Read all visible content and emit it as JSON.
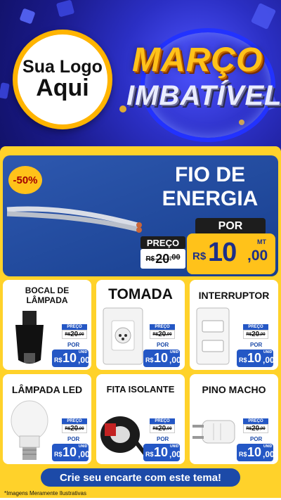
{
  "header": {
    "logo_line1": "Sua Logo",
    "logo_line2": "Aqui",
    "title_line1": "MARÇO",
    "title_line2": "IMBATÍVEL",
    "colors": {
      "background": "#2b2fc4",
      "title": "#ffc21a",
      "logo_ring": "#ffb400"
    }
  },
  "featured": {
    "discount": "-50%",
    "title_line1": "FIO DE",
    "title_line2": "ENERGIA",
    "por_label": "POR",
    "preco_label": "PREÇO",
    "old_currency": "R$",
    "old_int": "20",
    "old_cents": ",00",
    "currency": "R$",
    "price_int": "10",
    "price_cents": ",00",
    "unit": "MT",
    "image_icon": "wire-cable-icon"
  },
  "products": [
    {
      "name_line1": "BOCAL DE",
      "name_line2": "LÂMPADA",
      "icon": "socket-icon",
      "preco_label": "PREÇO",
      "old_currency": "R$",
      "old_int": "20",
      "old_cents": ",00",
      "por_label": "POR",
      "currency": "R$",
      "price_int": "10",
      "price_cents": ",00",
      "unit": "UNID"
    },
    {
      "name_line1": "TOMADA",
      "name_line2": "",
      "icon": "outlet-icon",
      "preco_label": "PREÇO",
      "old_currency": "R$",
      "old_int": "20",
      "old_cents": ",00",
      "por_label": "POR",
      "currency": "R$",
      "price_int": "10",
      "price_cents": ",00",
      "unit": "UNID"
    },
    {
      "name_line1": "INTERRUPTOR",
      "name_line2": "",
      "icon": "switch-icon",
      "preco_label": "PREÇO",
      "old_currency": "R$",
      "old_int": "20",
      "old_cents": ",00",
      "por_label": "POR",
      "currency": "R$",
      "price_int": "10",
      "price_cents": ",00",
      "unit": "UNID"
    },
    {
      "name_line1": "LÂMPADA LED",
      "name_line2": "",
      "icon": "led-bulb-icon",
      "preco_label": "PREÇO",
      "old_currency": "R$",
      "old_int": "20",
      "old_cents": ",00",
      "por_label": "POR",
      "currency": "R$",
      "price_int": "10",
      "price_cents": ",00",
      "unit": "UNID"
    },
    {
      "name_line1": "FITA ISOLANTE",
      "name_line2": "",
      "icon": "tape-icon",
      "preco_label": "PREÇO",
      "old_currency": "R$",
      "old_int": "20",
      "old_cents": ",00",
      "por_label": "POR",
      "currency": "R$",
      "price_int": "10",
      "price_cents": ",00",
      "unit": "UNID"
    },
    {
      "name_line1": "PINO MACHO",
      "name_line2": "",
      "icon": "plug-icon",
      "preco_label": "PREÇO",
      "old_currency": "R$",
      "old_int": "20",
      "old_cents": ",00",
      "por_label": "POR",
      "currency": "R$",
      "price_int": "10",
      "price_cents": ",00",
      "unit": "UNID"
    }
  ],
  "cta": {
    "label": "Crie seu encarte com este tema!"
  },
  "footer": {
    "disclaimer": "*Imagens Meramente Ilustrativas"
  }
}
